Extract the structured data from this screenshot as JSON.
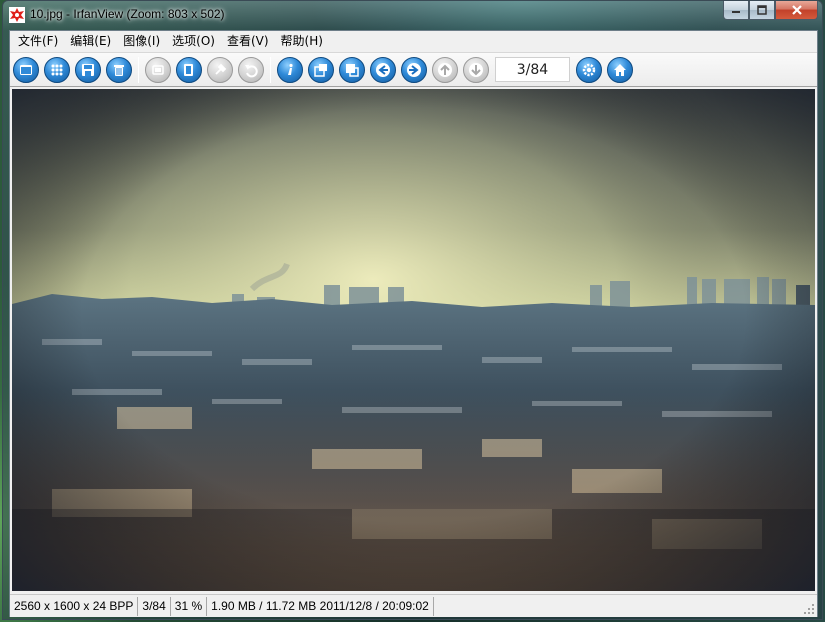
{
  "window": {
    "title": "10.jpg - IrfanView (Zoom: 803 x 502)",
    "controls": {
      "minimize_icon": "minimize-icon",
      "maximize_icon": "maximize-icon",
      "close_icon": "close-icon"
    }
  },
  "menu": {
    "items": [
      {
        "label": "文件(F)"
      },
      {
        "label": "编辑(E)"
      },
      {
        "label": "图像(I)"
      },
      {
        "label": "选项(O)"
      },
      {
        "label": "查看(V)"
      },
      {
        "label": "帮助(H)"
      }
    ]
  },
  "toolbar": {
    "buttons": [
      {
        "icon": "open-icon",
        "enabled": true
      },
      {
        "icon": "thumbnails-icon",
        "enabled": true
      },
      {
        "icon": "save-icon",
        "enabled": true
      },
      {
        "icon": "delete-icon",
        "enabled": true
      },
      {
        "icon": "rotate-icon",
        "enabled": false
      },
      {
        "icon": "copy-icon",
        "enabled": true
      },
      {
        "icon": "paste-icon",
        "enabled": false
      },
      {
        "icon": "undo-icon",
        "enabled": false
      },
      {
        "icon": "info-icon",
        "enabled": true
      },
      {
        "icon": "zoom-in-icon",
        "enabled": true
      },
      {
        "icon": "zoom-out-icon",
        "enabled": true
      },
      {
        "icon": "previous-icon",
        "enabled": true
      },
      {
        "icon": "next-icon",
        "enabled": true
      },
      {
        "icon": "up-icon",
        "enabled": false
      },
      {
        "icon": "down-icon",
        "enabled": false
      }
    ],
    "counter": "3/84",
    "after_counter": [
      {
        "icon": "settings-icon",
        "enabled": true
      },
      {
        "icon": "home-icon",
        "enabled": true
      }
    ]
  },
  "colors": {
    "accent": "#2f8ad8",
    "chrome": "#f0f0f0"
  },
  "status": {
    "dimensions": "2560 x 1600 x 24 BPP",
    "index": "3/84",
    "zoom": "31 %",
    "file_info": "1.90 MB / 11.72 MB  2011/12/8 / 20:09:02"
  }
}
